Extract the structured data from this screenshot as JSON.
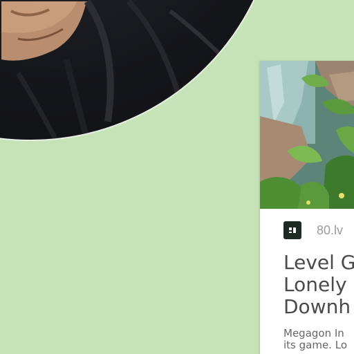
{
  "page": {
    "background_color": "#c6e3b7"
  },
  "profile": {
    "photo_icon": "profile-photo"
  },
  "card": {
    "image_icon": "jungle-waterfall-scene-image",
    "source": {
      "logo_icon": "80lv-logo-icon",
      "name": "80.lv"
    },
    "headline_lines": [
      "Level G",
      "Lonely",
      "Downh"
    ],
    "summary_lines": [
      "Megagon In",
      "its game. Lo"
    ]
  }
}
